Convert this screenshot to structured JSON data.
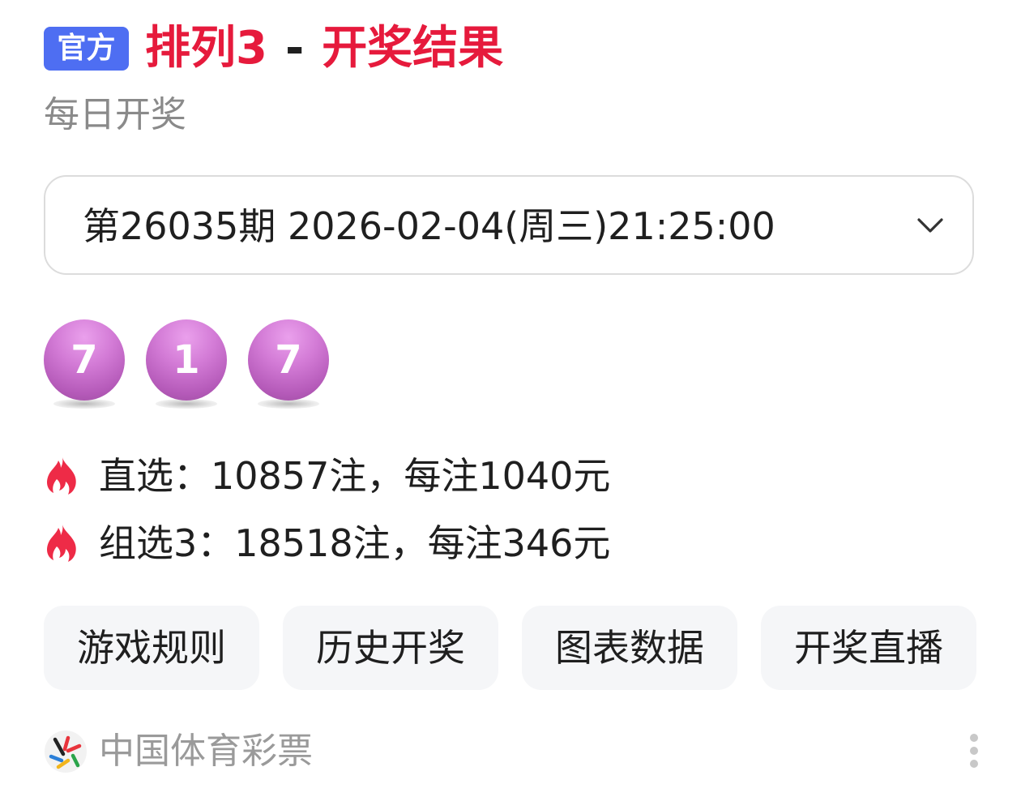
{
  "header": {
    "badge": "官方",
    "title_game": "排列3",
    "title_separator": "-",
    "title_result": "开奖结果",
    "subtitle": "每日开奖",
    "colors": {
      "badge_bg": "#4e6ef2",
      "title_red": "#e61a3c"
    }
  },
  "selector": {
    "value": "第26035期 2026-02-04(周三)21:25:00",
    "icon": "chevron-down-icon"
  },
  "draw": {
    "numbers": [
      "7",
      "1",
      "7"
    ],
    "ball_color": "#c86ecb"
  },
  "prizes": [
    {
      "icon": "fire-icon",
      "text": "直选：10857注，每注1040元"
    },
    {
      "icon": "fire-icon",
      "text": "组选3：18518注，每注346元"
    }
  ],
  "actions": [
    {
      "label": "游戏规则"
    },
    {
      "label": "历史开奖"
    },
    {
      "label": "图表数据"
    },
    {
      "label": "开奖直播"
    }
  ],
  "footer": {
    "source": "中国体育彩票",
    "logo_icon": "china-sports-lottery-logo",
    "more_icon": "more-vertical-icon"
  }
}
